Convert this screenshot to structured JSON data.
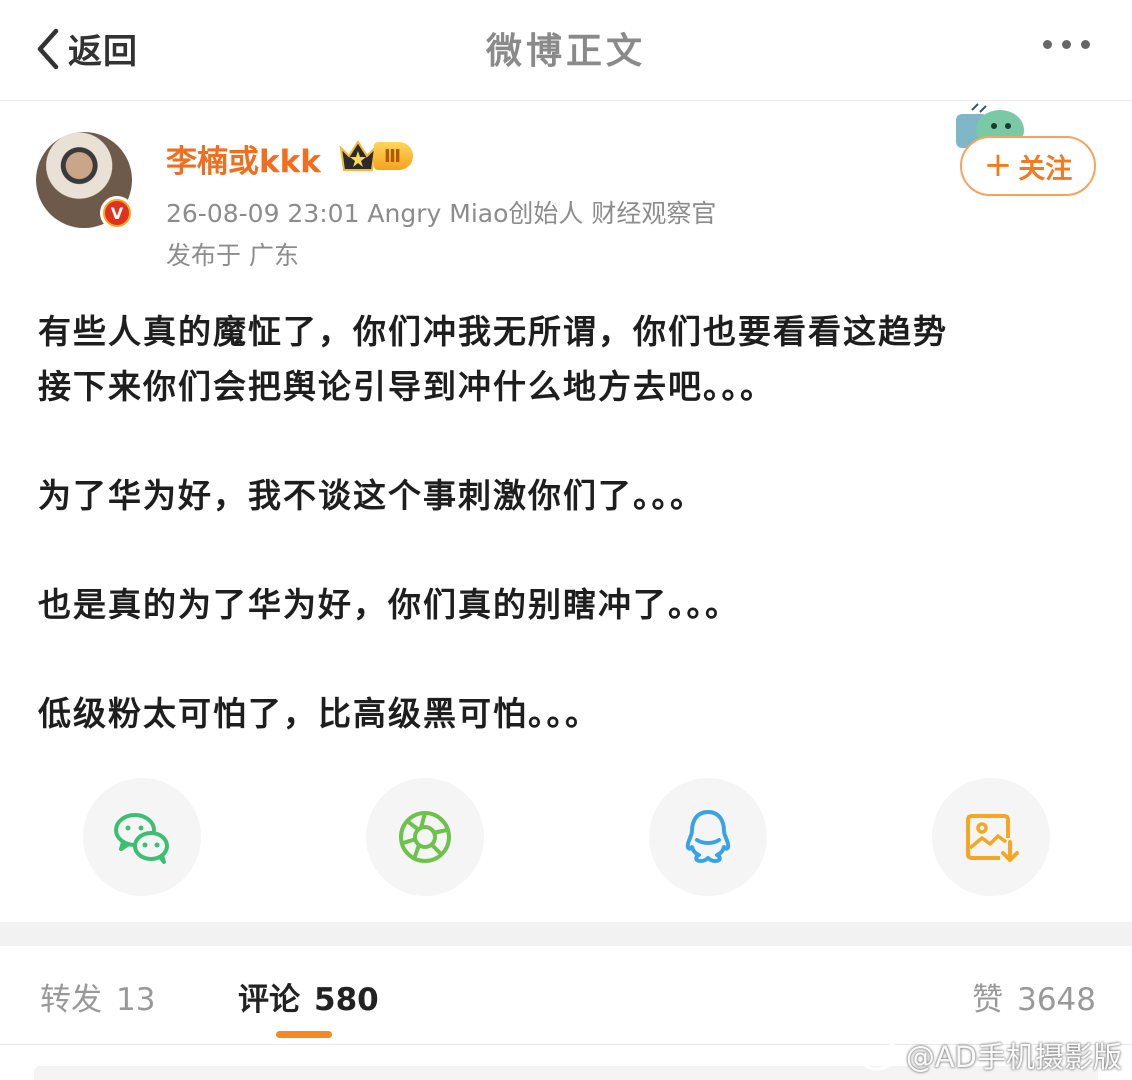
{
  "topbar": {
    "back_label": "返回",
    "title": "微博正文"
  },
  "author": {
    "name": "李楠或kkk",
    "vip_level": "Ⅲ",
    "meta": "26-08-09 23:01  Angry Miao创始人 财经观察官",
    "location": "发布于 广东",
    "verified_mark": "V"
  },
  "follow": {
    "plus": "+",
    "label": "关注"
  },
  "post": {
    "paragraphs": [
      "有些人真的魔怔了，你们冲我无所谓，你们也要看看这趋势\n接下来你们会把舆论引导到冲什么地方去吧。。。",
      "为了华为好，我不谈这个事刺激你们了。。。",
      "也是真的为了华为好，你们真的别瞎冲了。。。",
      "低级粉太可怕了，比高级黑可怕。。。"
    ]
  },
  "share": [
    {
      "icon": "wechat-icon",
      "color": "#3cbf72"
    },
    {
      "icon": "moments-icon",
      "color": "#6cc24a"
    },
    {
      "icon": "qq-icon",
      "color": "#3aa3e6"
    },
    {
      "icon": "save-image-icon",
      "color": "#f5a623"
    }
  ],
  "tabs": {
    "repost": {
      "label": "转发",
      "count": "13"
    },
    "comment": {
      "label": "评论",
      "count": "580"
    },
    "like": {
      "label": "赞",
      "count": "3648"
    }
  },
  "watermark": "@AD手机摄影版",
  "colors": {
    "accent": "#f06e1e",
    "tab_underline": "#f5891f"
  }
}
